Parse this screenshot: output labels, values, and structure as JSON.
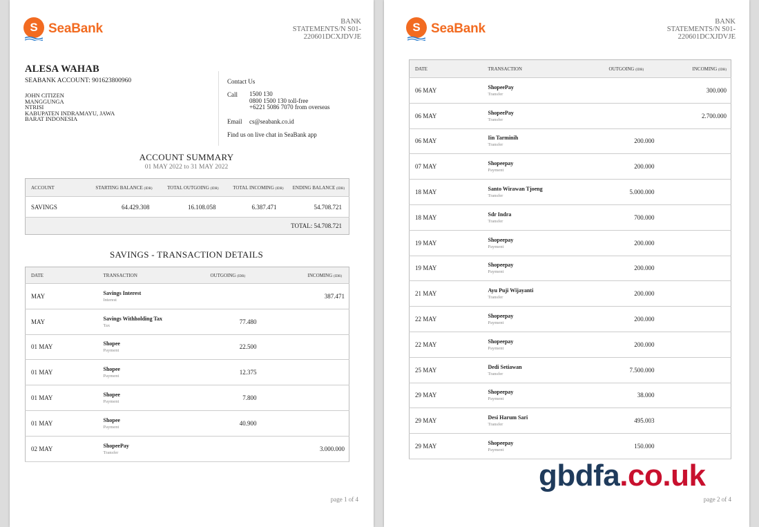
{
  "brand": {
    "name": "SeaBank",
    "letter": "S",
    "color": "#f26b21"
  },
  "statement_header": {
    "line1": "BANK",
    "line2": "STATEMENTS/N  S01-",
    "line3": "220601DCXJDVJE"
  },
  "customer": {
    "name": "ALESA WAHAB",
    "account": "SEABANK ACCOUNT: 901623800960",
    "address": [
      "JOHN CITIZEN",
      "MANGGUNGA",
      "NTRISI",
      "KABUPATEN INDRAMAYU, JAWA",
      "BARAT INDONESIA"
    ]
  },
  "contact": {
    "title": "Contact Us",
    "call_label": "Call",
    "call_lines": [
      "1500 130",
      "0800 1500 130 toll-free",
      "+6221 5086 7070 from overseas"
    ],
    "email_label": "Email",
    "email": "cs@seabank.co.id",
    "chat": "Find us on live chat in SeaBank app"
  },
  "summary": {
    "title": "ACCOUNT SUMMARY",
    "period": "01 MAY 2022 to 31 MAY 2022",
    "headers": [
      "ACCOUNT",
      "STARTING BALANCE",
      "TOTAL OUTGOING",
      "TOTAL INCOMING",
      "ENDING BALANCE"
    ],
    "unit": "(IDR)",
    "row": [
      "SAVINGS",
      "64.429.308",
      "16.108.058",
      "6.387.471",
      "54.708.721"
    ],
    "total": "TOTAL: 54.708.721"
  },
  "details_title": "SAVINGS - TRANSACTION DETAILS",
  "tx_headers": {
    "date": "DATE",
    "transaction": "TRANSACTION",
    "outgoing": "OUTGOING",
    "incoming": "INCOMING",
    "unit": "(IDR)"
  },
  "page1_tx": [
    {
      "date": "MAY",
      "name": "Savings Interest",
      "type": "Interest",
      "out": "",
      "in": "387.471"
    },
    {
      "date": "MAY",
      "name": "Savings Withholding Tax",
      "type": "Tax",
      "out": "77.480",
      "in": ""
    },
    {
      "date": "01 MAY",
      "name": "Shopee",
      "type": "Payment",
      "out": "22.500",
      "in": ""
    },
    {
      "date": "01 MAY",
      "name": "Shopee",
      "type": "Payment",
      "out": "12.375",
      "in": ""
    },
    {
      "date": "01 MAY",
      "name": "Shopee",
      "type": "Payment",
      "out": "7.800",
      "in": ""
    },
    {
      "date": "01 MAY",
      "name": "Shopee",
      "type": "Payment",
      "out": "40.900",
      "in": ""
    },
    {
      "date": "02 MAY",
      "name": "ShopeePay",
      "type": "Transfer",
      "out": "",
      "in": "3.000.000"
    }
  ],
  "page2_tx": [
    {
      "date": "06 MAY",
      "name": "ShopeePay",
      "type": "Transfer",
      "out": "",
      "in": "300.000"
    },
    {
      "date": "06 MAY",
      "name": "ShopeePay",
      "type": "Transfer",
      "out": "",
      "in": "2.700.000"
    },
    {
      "date": "06 MAY",
      "name": "Iin Tarminih",
      "type": "Transfer",
      "out": "200.000",
      "in": ""
    },
    {
      "date": "07 MAY",
      "name": "Shopeepay",
      "type": "Payment",
      "out": "200.000",
      "in": ""
    },
    {
      "date": "18 MAY",
      "name": "Santo Wirawan Tjoeng",
      "type": "Transfer",
      "out": "5.000.000",
      "in": ""
    },
    {
      "date": "18 MAY",
      "name": "Sdr Indra",
      "type": "Transfer",
      "out": "700.000",
      "in": ""
    },
    {
      "date": "19 MAY",
      "name": "Shopeepay",
      "type": "Payment",
      "out": "200.000",
      "in": ""
    },
    {
      "date": "19 MAY",
      "name": "Shopeepay",
      "type": "Payment",
      "out": "200.000",
      "in": ""
    },
    {
      "date": "21 MAY",
      "name": "Ayu Puji Wijayanti",
      "type": "Transfer",
      "out": "200.000",
      "in": ""
    },
    {
      "date": "22 MAY",
      "name": "Shopeepay",
      "type": "Payment",
      "out": "200.000",
      "in": ""
    },
    {
      "date": "22 MAY",
      "name": "Shopeepay",
      "type": "Payment",
      "out": "200.000",
      "in": ""
    },
    {
      "date": "25 MAY",
      "name": "Dedi Setiawan",
      "type": "Transfer",
      "out": "7.500.000",
      "in": ""
    },
    {
      "date": "29 MAY",
      "name": "Shopeepay",
      "type": "Payment",
      "out": "38.000",
      "in": ""
    },
    {
      "date": "29 MAY",
      "name": "Desi Harum Sari",
      "type": "Transfer",
      "out": "495.003",
      "in": ""
    },
    {
      "date": "29 MAY",
      "name": "Shopeepay",
      "type": "Payment",
      "out": "150.000",
      "in": ""
    }
  ],
  "page1_number": "page 1 of 4",
  "page2_number": "page 2 of 4",
  "watermark": {
    "part1": "gbdfa",
    "part2": ".co.uk",
    "color1": "#1f3b5c",
    "color2": "#c8102e"
  }
}
